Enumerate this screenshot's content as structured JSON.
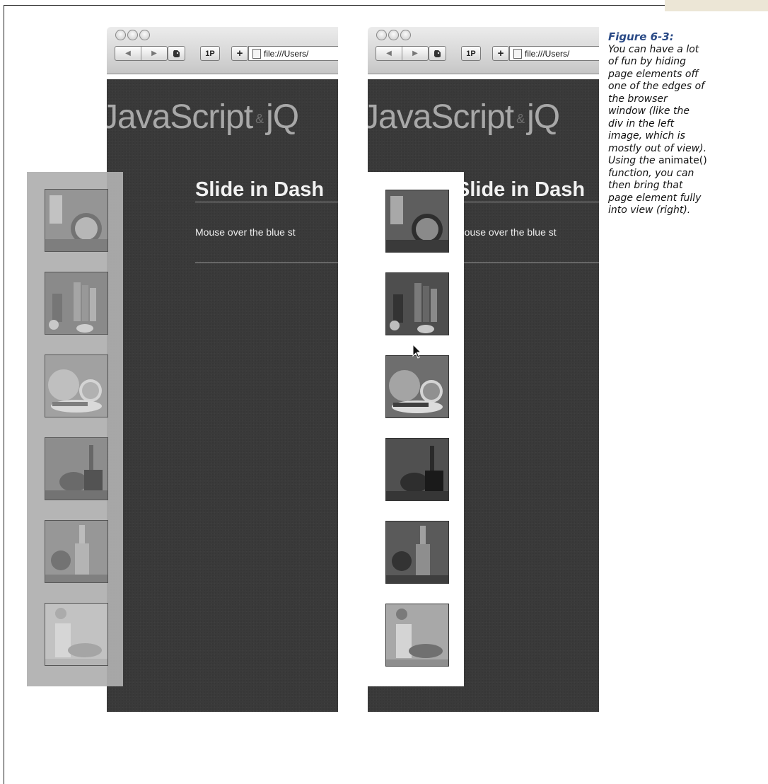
{
  "browser": {
    "nav_back": "◀",
    "nav_forward": "▶",
    "btn_1p": "1P",
    "btn_plus": "+",
    "url": "file:///Users/"
  },
  "page": {
    "site_title_part1": "JavaScript",
    "site_title_amp": "&",
    "site_title_part2": "jQ",
    "heading": "Slide in Dash",
    "paragraph": "Mouse over the blue st"
  },
  "thumbnails": [
    "still-life-clock",
    "still-life-books",
    "still-life-fruit",
    "still-life-teapot",
    "still-life-bottle",
    "still-life-vase"
  ],
  "caption": {
    "figure_label": "Figure 6-3:",
    "text_before_code": "You can have a lot of fun by hiding page elements off one of the edges of the browser window (like the div in the left image, which is mostly out of view). Using the ",
    "code": "animate()",
    "text_after_code": " function, you can then bring that page element fully into view (right)."
  },
  "colors": {
    "page_background": "#3a3a3a",
    "figure_label": "#2a4a86",
    "hidden_panel": "#afafaf",
    "visible_panel": "#ffffff"
  }
}
